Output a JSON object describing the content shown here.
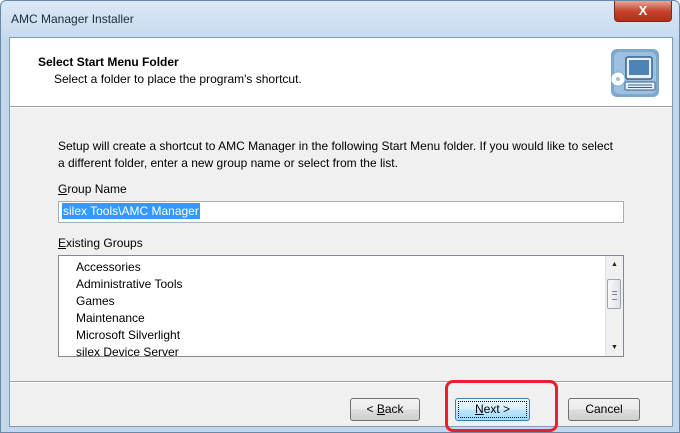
{
  "window": {
    "title": "AMC Manager Installer",
    "close_glyph": "X"
  },
  "header": {
    "title": "Select Start Menu Folder",
    "subtitle": "Select a folder to place the program's shortcut.",
    "icon": "computer-icon"
  },
  "body": {
    "description": "Setup will create a shortcut to AMC Manager in the following Start Menu folder. If you would like to select a different folder, enter a new group name or select from the list.",
    "group_name_label_accel": "G",
    "group_name_label_rest": "roup Name",
    "group_name_value": "silex Tools\\AMC Manager",
    "existing_groups_label_accel": "E",
    "existing_groups_label_rest": "xisting Groups",
    "existing_groups": [
      "Accessories",
      "Administrative Tools",
      "Games",
      "Maintenance",
      "Microsoft Silverlight",
      "silex Device Server"
    ]
  },
  "buttons": {
    "back_prefix": "< ",
    "back_accel": "B",
    "back_rest": "ack",
    "next_accel": "N",
    "next_rest": "ext >",
    "cancel": "Cancel"
  },
  "colors": {
    "highlight": "#e8202a",
    "selection": "#3399ff",
    "close_button": "#c7442f"
  }
}
